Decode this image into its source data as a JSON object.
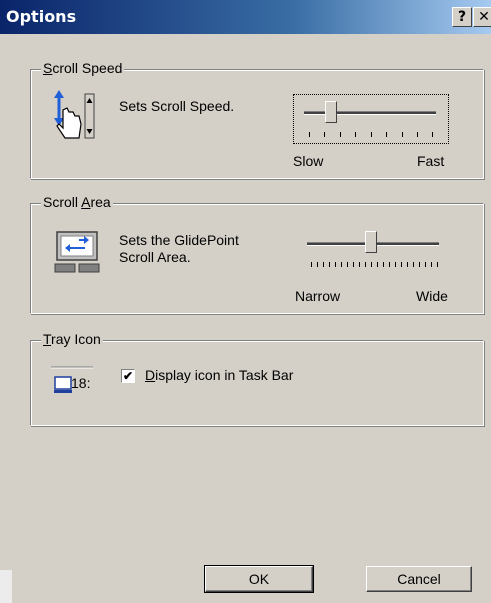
{
  "window": {
    "title": "Options",
    "help_glyph": "?",
    "close_glyph": "✕"
  },
  "scroll_speed": {
    "legend_prefix": "",
    "legend_accel": "S",
    "legend_rest": "croll Speed",
    "description": "Sets Scroll Speed.",
    "label_min": "Slow",
    "label_max": "Fast",
    "value_fraction": 0.22
  },
  "scroll_area": {
    "legend_prefix": "Scroll ",
    "legend_accel": "A",
    "legend_rest": "rea",
    "description_line1": "Sets the GlidePoint",
    "description_line2": "Scroll Area.",
    "label_min": "Narrow",
    "label_max": "Wide",
    "value_fraction": 0.52
  },
  "tray_icon": {
    "legend_accel": "T",
    "legend_rest": "ray Icon",
    "icon_text": "18:",
    "checkbox_checked": true,
    "checkbox_accel": "D",
    "checkbox_rest": "isplay icon in Task Bar"
  },
  "buttons": {
    "ok": "OK",
    "cancel": "Cancel"
  },
  "colors": {
    "face": "#d4d0c8",
    "title_start": "#0a246a",
    "title_end": "#a6caf0",
    "icon_blue": "#1f5fd8"
  }
}
